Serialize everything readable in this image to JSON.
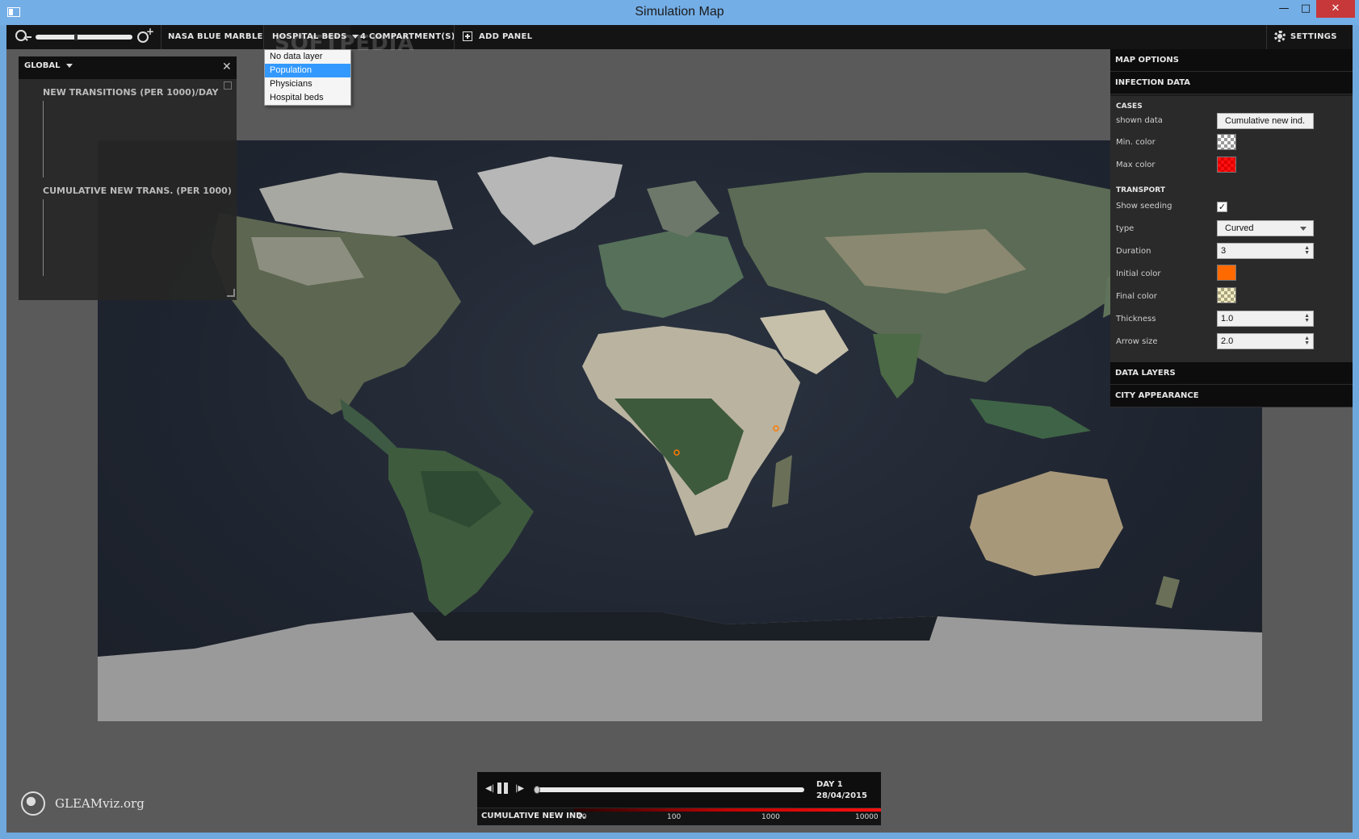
{
  "window": {
    "title": "Simulation Map",
    "min": "—",
    "max": "□",
    "close": "✕"
  },
  "toolbar": {
    "basemap": "NASA BLUE MARBLE",
    "data_layer": "HOSPITAL BEDS",
    "compartments": "4 COMPARTMENT(S)",
    "add_panel": "ADD PANEL",
    "settings": "SETTINGS",
    "zoom_level": 0.7
  },
  "watermark": "SOFTPEDIA",
  "data_layer_menu": {
    "items": [
      "No data layer",
      "Population",
      "Physicians",
      "Hospital beds"
    ],
    "highlighted": "Population"
  },
  "left_panel": {
    "scope": "GLOBAL",
    "close": "✕",
    "chart1_title": "NEW TRANSITIONS (PER 1000)/DAY",
    "chart2_title": "CUMULATIVE NEW TRANS. (PER 1000)"
  },
  "settings_panel": {
    "sections": {
      "map_options": "MAP OPTIONS",
      "infection_data": "INFECTION DATA",
      "data_layers": "DATA LAYERS",
      "city_appearance": "CITY APPEARANCE"
    },
    "cases": {
      "heading": "CASES",
      "shown_data_label": "shown data",
      "shown_data_value": "Cumulative new ind.",
      "min_color_label": "Min. color",
      "max_color_label": "Max color"
    },
    "transport": {
      "heading": "TRANSPORT",
      "show_seeding_label": "Show seeding",
      "show_seeding_checked": "✓",
      "type_label": "type",
      "type_value": "Curved",
      "duration_label": "Duration",
      "duration_value": "3",
      "initial_color_label": "Initial color",
      "final_color_label": "Final color",
      "thickness_label": "Thickness",
      "thickness_value": "1.0",
      "arrow_size_label": "Arrow size",
      "arrow_size_value": "2.0"
    },
    "colors": {
      "initial": "#ff6a00",
      "max": "#ff1010"
    }
  },
  "playback": {
    "day": "DAY 1",
    "date": "28/04/2015",
    "legend_title": "CUMULATIVE NEW IND.",
    "ticks": [
      "10",
      "100",
      "1000",
      "10000"
    ],
    "progress": 0.0
  },
  "logo": {
    "text": "GLEAMviz.org"
  }
}
